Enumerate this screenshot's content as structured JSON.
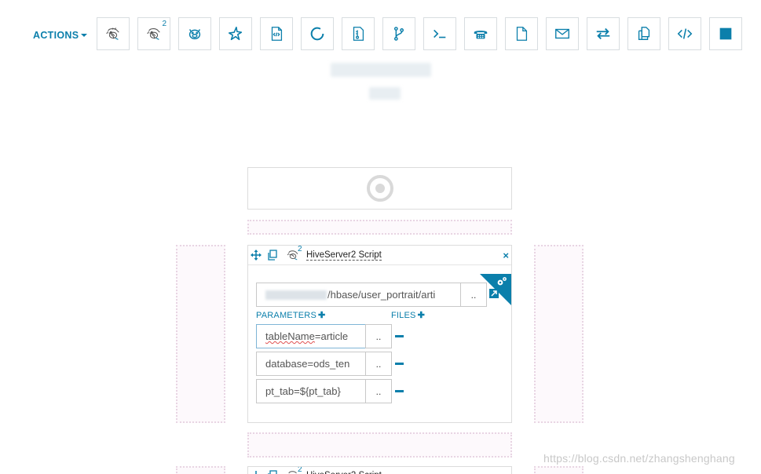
{
  "actions": {
    "label": "ACTIONS"
  },
  "toolbar": {
    "buttons": [
      {
        "icon": "hive-icon",
        "label": "Hive"
      },
      {
        "icon": "hive2-icon",
        "label": "HiveServer2",
        "sup": "2"
      },
      {
        "icon": "pig-icon",
        "label": "Pig"
      },
      {
        "icon": "spark-icon",
        "label": "Spark"
      },
      {
        "icon": "java-file-icon",
        "label": "Java"
      },
      {
        "icon": "sqoop-icon",
        "label": "Sqoop"
      },
      {
        "icon": "mapreduce-icon",
        "label": "MapReduce"
      },
      {
        "icon": "subworkflow-icon",
        "label": "Sub workflow"
      },
      {
        "icon": "shell-icon",
        "label": "Shell"
      },
      {
        "icon": "ssh-icon",
        "label": "Ssh"
      },
      {
        "icon": "fs-icon",
        "label": "Fs"
      },
      {
        "icon": "email-icon",
        "label": "Email"
      },
      {
        "icon": "streaming-icon",
        "label": "Streaming"
      },
      {
        "icon": "distcp-icon",
        "label": "DistCp"
      },
      {
        "icon": "generic-icon",
        "label": "Generic"
      },
      {
        "icon": "kill-icon",
        "label": "Kill"
      }
    ]
  },
  "node": {
    "title": "HiveServer2 Script",
    "title_sup": "2",
    "script_path": "/hbase/user_portrait/arti",
    "dots": "..",
    "parameters_label": "PARAMETERS",
    "files_label": "FILES",
    "plus": "✚",
    "close": "×",
    "params": [
      {
        "value": "tableName=article",
        "spell_part": "tableName",
        "rest_part": "=article"
      },
      {
        "value": "database=ods_ten"
      },
      {
        "value": "pt_tab=${pt_tab}"
      }
    ]
  },
  "watermark": "https://blog.csdn.net/zhangshenghang",
  "colors": {
    "accent": "#0b7fab",
    "dropzone": "#e8d5e3"
  }
}
